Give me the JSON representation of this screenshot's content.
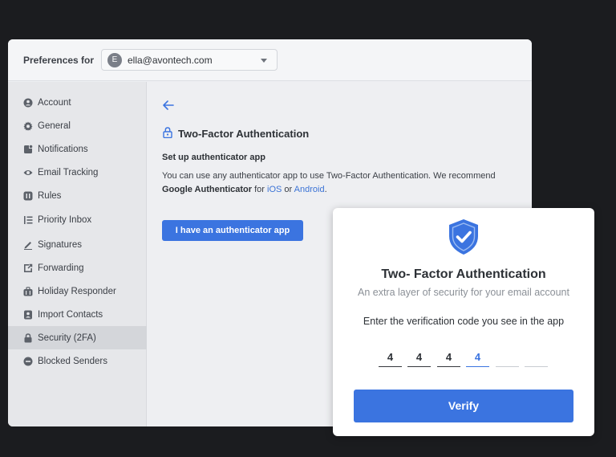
{
  "header": {
    "label": "Preferences for",
    "account": {
      "avatar_initial": "E",
      "email": "ella@avontech.com"
    }
  },
  "sidebar": {
    "items": [
      {
        "label": "Account",
        "icon": "user-circle-icon"
      },
      {
        "label": "General",
        "icon": "gear-icon"
      },
      {
        "label": "Notifications",
        "icon": "notification-icon"
      },
      {
        "label": "Email Tracking",
        "icon": "eye-icon"
      },
      {
        "label": "Rules",
        "icon": "rules-icon"
      },
      {
        "label": "Priority Inbox",
        "icon": "priority-list-icon"
      },
      {
        "label": "Signatures",
        "icon": "pen-icon"
      },
      {
        "label": "Forwarding",
        "icon": "forward-icon"
      },
      {
        "label": "Holiday Responder",
        "icon": "suitcase-icon"
      },
      {
        "label": "Import Contacts",
        "icon": "contacts-icon"
      },
      {
        "label": "Security (2FA)",
        "icon": "lock-icon",
        "active": true
      },
      {
        "label": "Blocked Senders",
        "icon": "block-icon"
      }
    ]
  },
  "content": {
    "title": "Two-Factor Authentication",
    "subtitle": "Set up authenticator app",
    "desc_1": "You can use any authenticator app to use Two-Factor Authentication. We recommend",
    "desc_app": "Google Authenticator",
    "desc_for": "for",
    "desc_ios": "iOS",
    "desc_or": "or",
    "desc_android": "Android",
    "desc_end": ".",
    "button": "I have an authenticator app"
  },
  "modal": {
    "title": "Two- Factor Authentication",
    "subtitle": "An extra layer of security for your email account",
    "instruction": "Enter the verification code you see in the app",
    "code": [
      "4",
      "4",
      "4",
      "4",
      "",
      ""
    ],
    "verify": "Verify"
  },
  "colors": {
    "accent": "#3b74e0",
    "background": "#1b1c1f"
  }
}
